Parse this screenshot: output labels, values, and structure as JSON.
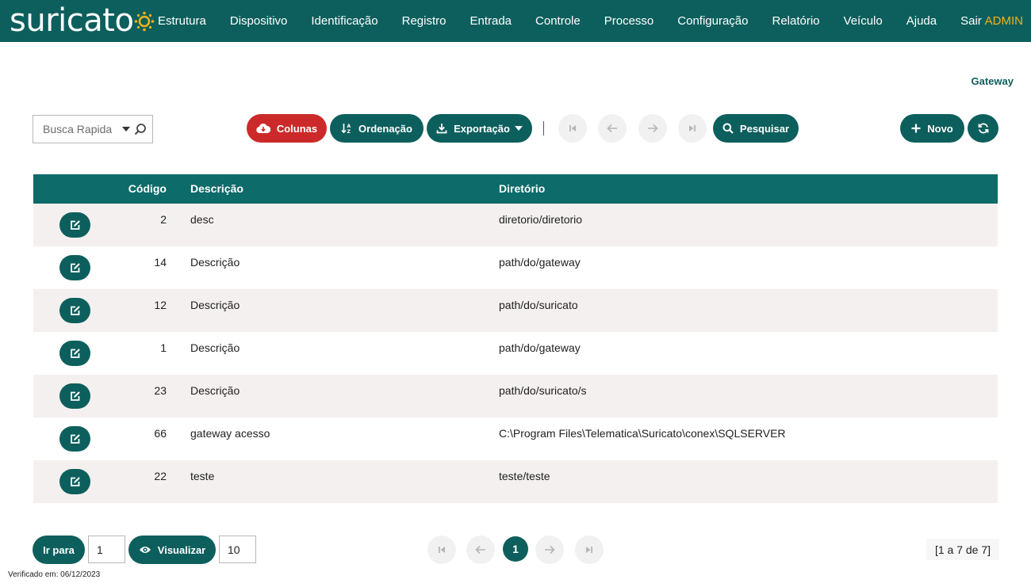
{
  "app": {
    "logo_text": "suricato",
    "user": "ADMIN"
  },
  "nav": {
    "items": [
      "Estrutura",
      "Dispositivo",
      "Identificação",
      "Registro",
      "Entrada",
      "Controle",
      "Processo",
      "Configuração",
      "Relatório",
      "Veículo",
      "Ajuda",
      "Sair"
    ]
  },
  "page": {
    "label": "Gateway"
  },
  "toolbar": {
    "search_placeholder": "Busca Rapida",
    "columns_label": "Colunas",
    "order_label": "Ordenação",
    "export_label": "Exportação",
    "search_label": "Pesquisar",
    "new_label": "Novo"
  },
  "table": {
    "headers": {
      "code": "Código",
      "description": "Descrição",
      "directory": "Diretório"
    },
    "rows": [
      {
        "code": "2",
        "description": "desc",
        "directory": "diretorio/diretorio"
      },
      {
        "code": "14",
        "description": "Descrição",
        "directory": "path/do/gateway"
      },
      {
        "code": "12",
        "description": "Descrição",
        "directory": "path/do/suricato"
      },
      {
        "code": "1",
        "description": "Descrição",
        "directory": "path/do/gateway"
      },
      {
        "code": "23",
        "description": "Descrição",
        "directory": "path/do/suricato/s"
      },
      {
        "code": "66",
        "description": "gateway acesso",
        "directory": "C:\\Program Files\\Telematica\\Suricato\\conex\\SQLSERVER"
      },
      {
        "code": "22",
        "description": "teste",
        "directory": "teste/teste"
      }
    ]
  },
  "footer": {
    "goto_label": "Ir para",
    "goto_value": "1",
    "view_label": "Visualizar",
    "view_value": "10",
    "current_page": "1",
    "count_text": "[1 a 7 de 7]",
    "verified": "Verificado em: 06/12/2023"
  },
  "colors": {
    "primary": "#0d5f5d",
    "header": "#0d6b6a",
    "danger": "#cc2a2a",
    "accent": "#f5b21a",
    "row_alt": "#f3f0ef"
  },
  "icons": {
    "columns": "cloud-download-icon",
    "order": "sort-icon",
    "export": "download-icon",
    "search": "search-icon",
    "new": "plus-icon",
    "refresh": "refresh-icon",
    "edit": "edit-icon",
    "view": "eye-icon"
  }
}
